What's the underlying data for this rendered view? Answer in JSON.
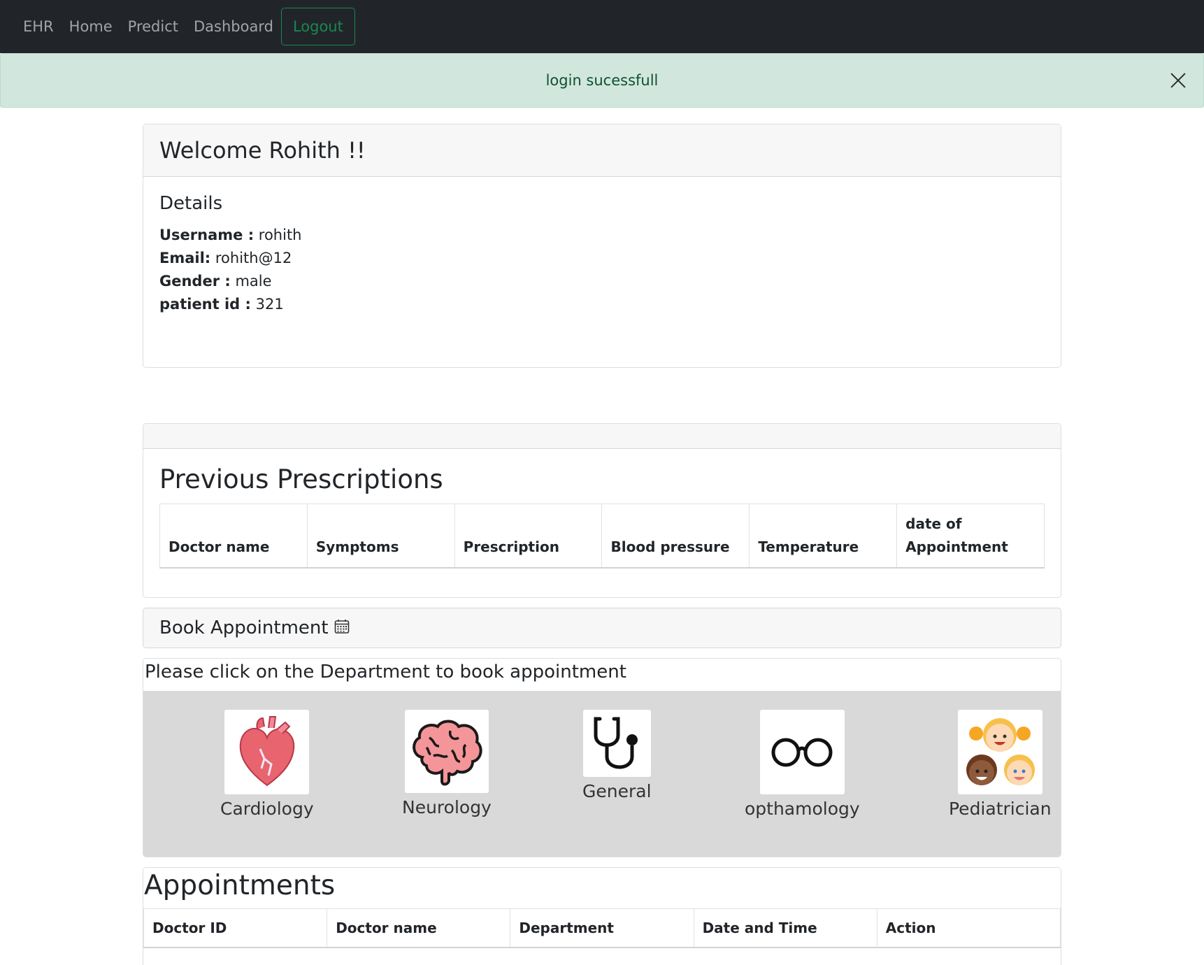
{
  "navbar": {
    "brand": "EHR",
    "links": [
      "Home",
      "Predict",
      "Dashboard"
    ],
    "logout_label": "Logout"
  },
  "alert": {
    "message": "login sucessfull"
  },
  "welcome": {
    "title": "Welcome Rohith !!",
    "details_heading": "Details",
    "fields": [
      {
        "label": "Username :",
        "value": " rohith"
      },
      {
        "label": "Email:",
        "value": " rohith@12"
      },
      {
        "label": "Gender :",
        "value": " male"
      },
      {
        "label": "patient id :",
        "value": " 321"
      }
    ]
  },
  "prescriptions": {
    "title": "Previous Prescriptions",
    "columns": [
      "Doctor name",
      "Symptoms",
      "Prescription",
      "Blood pressure",
      "Temperature",
      "date of Appointment"
    ]
  },
  "book": {
    "title": "Book Appointment",
    "instruction": "Please click on the Department to book appointment",
    "departments": [
      {
        "label": "Cardiology",
        "icon": "heart-icon"
      },
      {
        "label": "Neurology",
        "icon": "brain-icon"
      },
      {
        "label": "General",
        "icon": "stethoscope-icon"
      },
      {
        "label": "opthamology",
        "icon": "glasses-icon"
      },
      {
        "label": "Pediatrician",
        "icon": "children-icon"
      }
    ]
  },
  "appointments": {
    "title": "Appointments",
    "columns": [
      "Doctor ID",
      "Doctor name",
      "Department",
      "Date and Time",
      "Action"
    ]
  },
  "colors": {
    "navbar_bg": "#212529",
    "success": "#198754",
    "alert_bg": "#d1e7dd",
    "alert_text": "#0f5132"
  }
}
